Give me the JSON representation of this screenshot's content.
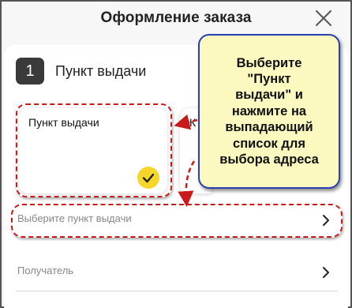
{
  "header": {
    "title": "Оформление заказа"
  },
  "step": {
    "number": "1",
    "title": "Пункт выдачи"
  },
  "delivery_options": [
    {
      "label": "Пункт выдачи",
      "selected": true
    },
    {
      "label": "К",
      "selected": false
    }
  ],
  "rows": {
    "select_pickup_point": "Выберите пункт выдачи",
    "recipient": "Получатель"
  },
  "callout": {
    "text": "Выберите\n\"Пункт\nвыдачи\" и\nнажмите на\nвыпадающий\nсписок для\nвыбора адреса"
  },
  "colors": {
    "accent_yellow": "#f6d62a",
    "annotation_red": "#c81a1a",
    "callout_border": "#2a3fb0",
    "callout_fill": "#fbf9bf"
  },
  "icons": {
    "close": "close-icon",
    "check": "check-icon",
    "chevron": "chevron-right-icon"
  }
}
